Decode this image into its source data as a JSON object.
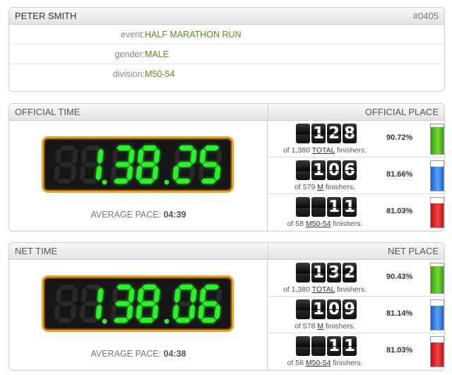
{
  "athlete": {
    "name": "PETER SMITH",
    "bib": "#0405"
  },
  "info": [
    {
      "label": "event:",
      "value": "HALF MARATHON RUN"
    },
    {
      "label": "gender:",
      "value": "MALE"
    },
    {
      "label": "division:",
      "value": "M50-54"
    }
  ],
  "official": {
    "time_label": "OFFICIAL TIME",
    "place_label": "OFFICIAL PLACE",
    "clock_digits": [
      "",
      "1",
      "3",
      "8",
      "2",
      "5"
    ],
    "pace_label": "AVERAGE PACE:",
    "pace": "04:39",
    "places": [
      {
        "digits": [
          "",
          "1",
          "2",
          "8"
        ],
        "of": "of 1,380",
        "group": "TOTAL",
        "tail": "finishers.",
        "percent": "90.72%",
        "fill": 0.9072,
        "color": "green"
      },
      {
        "digits": [
          "",
          "1",
          "0",
          "6"
        ],
        "of": "of 579",
        "group": "M",
        "tail": "finishers.",
        "percent": "81.66%",
        "fill": 0.8166,
        "color": "blue"
      },
      {
        "digits": [
          "",
          "",
          "1",
          "1"
        ],
        "of": "of 58",
        "group": "M50-54",
        "tail": "finishers.",
        "percent": "81.03%",
        "fill": 0.8103,
        "color": "red"
      }
    ]
  },
  "net": {
    "time_label": "NET TIME",
    "place_label": "NET PLACE",
    "clock_digits": [
      "",
      "1",
      "3",
      "8",
      "0",
      "6"
    ],
    "pace_label": "AVERAGE PACE:",
    "pace": "04:38",
    "places": [
      {
        "digits": [
          "",
          "1",
          "3",
          "2"
        ],
        "of": "of 1,380",
        "group": "TOTAL",
        "tail": "finishers.",
        "percent": "90.43%",
        "fill": 0.9043,
        "color": "green"
      },
      {
        "digits": [
          "",
          "1",
          "0",
          "9"
        ],
        "of": "of 578",
        "group": "M",
        "tail": "finishers.",
        "percent": "81.14%",
        "fill": 0.8114,
        "color": "blue"
      },
      {
        "digits": [
          "",
          "",
          "1",
          "1"
        ],
        "of": "of 58",
        "group": "M50-54",
        "tail": "finishers.",
        "percent": "81.03%",
        "fill": 0.8103,
        "color": "red"
      }
    ]
  },
  "colors": {
    "lit_segment": "#2bf02b",
    "unlit_segment": "#2a2a2a",
    "clock_border": "#f0a020",
    "value_text": "#5e8a1c"
  }
}
